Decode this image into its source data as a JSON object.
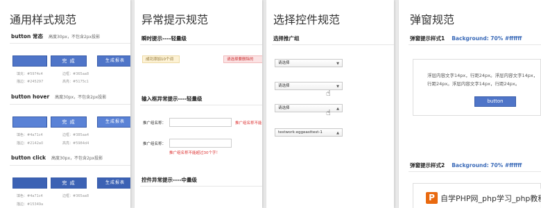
{
  "panel1": {
    "title": "通用样式规范",
    "normal": {
      "label": "button 常态",
      "note": "高度30px，不包含2px投影",
      "button1": "完 成",
      "button2": "生成报表",
      "specs": [
        "填充：#5974c4",
        "边框：#365aa8",
        "描边：#245297",
        "高亮：#5175c1"
      ]
    },
    "hover": {
      "label": "button hover",
      "note": "高度30px，不包含2px投影",
      "button1": "完 成",
      "button2": "生成报表",
      "specs": [
        "填色：#4a71c4",
        "边框：#385aa4",
        "描边：#2142a0",
        "高亮：#5984d4"
      ]
    },
    "click": {
      "label": "button click",
      "note": "高度30px，不包含2px投影",
      "button1": "完 成",
      "button2": "生成报表",
      "specs": [
        "填色：#4a71c4",
        "边框：#365aa8",
        "描边：#15349a"
      ]
    }
  },
  "panel2": {
    "title": "异常提示规范",
    "sec1": "瞬时提示----轻量级",
    "tip_success": "成功添加10个词",
    "tip_error": "请选择要删除的",
    "sec2": "输入框异常提示----轻量级",
    "field1_label": "推广组名称：",
    "field1_error": "推广组名称不能",
    "field2_label": "推广组名称：",
    "field2_error": "推广组名称不能超过30个字！",
    "sec3": "控件异常提示----中量级"
  },
  "panel3": {
    "title": "选择控件规范",
    "sec1": "选择推广组",
    "selects": [
      {
        "value": "请选择",
        "arrow": "▼"
      },
      {
        "value": "请选择",
        "arrow": "▼"
      },
      {
        "value": "请选择",
        "arrow": "▲"
      },
      {
        "value": "testwork:eggeasttest-1",
        "arrow": "▲"
      }
    ]
  },
  "panel4": {
    "title": "弹窗规范",
    "sec1": "弹窗提示样式1",
    "bg1": "Background: 70% #ffffff",
    "dialog_text1": "浮层内容文字14px，行距24px。浮层内容文字14px，",
    "dialog_text2": "行距24px。浮层内容文字14px，行距24px。",
    "dialog_button": "button",
    "sec2": "弹窗提示样式2",
    "bg2": "Background: 70% #ffffff"
  },
  "watermark": {
    "logo": "P",
    "text": "自学PHP网_php学习_php教程"
  },
  "colors": {
    "button_blue": "#4f75c8",
    "button_border": "#365aa8",
    "error_red": "#d33333",
    "page_bg": "#e9e9e9"
  }
}
